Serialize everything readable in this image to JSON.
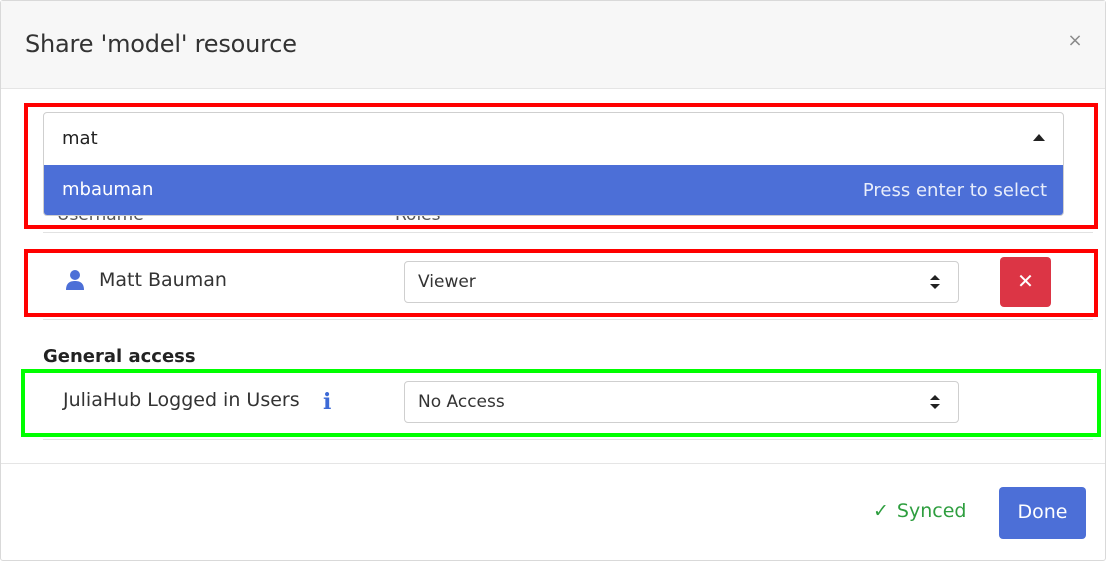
{
  "dialog": {
    "title": "Share 'model' resource",
    "close_glyph": "×"
  },
  "search": {
    "value": "mat",
    "option_label": "mbauman",
    "option_hint": "Press enter to select"
  },
  "table": {
    "col_username": "Username",
    "col_roles": "Roles"
  },
  "user_row": {
    "name": "Matt Bauman",
    "role": "Viewer",
    "remove_glyph": "✕"
  },
  "general_access": {
    "title": "General access",
    "group": "JuliaHub Logged in Users",
    "info_glyph": "i",
    "access": "No Access"
  },
  "footer": {
    "status_glyph": "✓",
    "status": "Synced",
    "done_label": "Done"
  },
  "colors": {
    "primary": "#4c6fd7",
    "danger": "#dc3545",
    "success": "#2e9e3f",
    "highlight_red": "#ff0000",
    "highlight_green": "#00ff00"
  },
  "icons": {
    "close": "close-icon",
    "person": "person-icon",
    "remove": "close-icon",
    "info": "info-icon",
    "check": "check-icon",
    "dropdown": "caret-up-icon",
    "select": "updown-icon"
  }
}
